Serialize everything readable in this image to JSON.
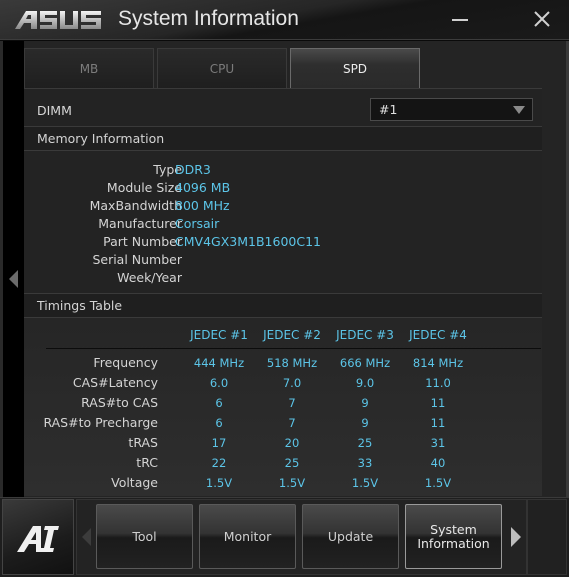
{
  "window": {
    "brand": "ASUS",
    "title": "System Information",
    "minimize_icon": "minimize-icon",
    "close_icon": "close-icon"
  },
  "tabs": [
    {
      "label": "MB",
      "active": false
    },
    {
      "label": "CPU",
      "active": false
    },
    {
      "label": "SPD",
      "active": true
    }
  ],
  "dimm": {
    "label": "DIMM",
    "selected": "#1"
  },
  "memory_information": {
    "heading": "Memory Information",
    "rows": [
      {
        "key": "Type",
        "value": "DDR3"
      },
      {
        "key": "Module Size",
        "value": "4096 MB"
      },
      {
        "key": "MaxBandwidth",
        "value": "800 MHz"
      },
      {
        "key": "Manufacturer",
        "value": "Corsair"
      },
      {
        "key": "Part Number",
        "value": "CMV4GX3M1B1600C11"
      },
      {
        "key": "Serial Number",
        "value": ""
      },
      {
        "key": "Week/Year",
        "value": ""
      }
    ]
  },
  "timings_table": {
    "heading": "Timings Table",
    "columns": [
      "JEDEC #1",
      "JEDEC #2",
      "JEDEC #3",
      "JEDEC #4"
    ],
    "rows": [
      {
        "key": "Frequency",
        "values": [
          "444 MHz",
          "518 MHz",
          "666 MHz",
          "814 MHz"
        ]
      },
      {
        "key": "CAS#Latency",
        "values": [
          "6.0",
          "7.0",
          "9.0",
          "11.0"
        ]
      },
      {
        "key": "RAS#to CAS",
        "values": [
          "6",
          "7",
          "9",
          "11"
        ]
      },
      {
        "key": "RAS#to Precharge",
        "values": [
          "6",
          "7",
          "9",
          "11"
        ]
      },
      {
        "key": "tRAS",
        "values": [
          "17",
          "20",
          "25",
          "31"
        ]
      },
      {
        "key": "tRC",
        "values": [
          "22",
          "25",
          "33",
          "40"
        ]
      },
      {
        "key": "Voltage",
        "values": [
          "1.5V",
          "1.5V",
          "1.5V",
          "1.5V"
        ]
      }
    ]
  },
  "bottom_nav": {
    "suite_logo": "AI",
    "buttons": [
      {
        "label": "Tool"
      },
      {
        "label": "Monitor"
      },
      {
        "label": "Update"
      },
      {
        "label": "System\nInformation",
        "active": true
      }
    ]
  },
  "colors": {
    "value_text": "#5cc5e8",
    "label_text": "#d4d4d4",
    "background": "#232323"
  }
}
